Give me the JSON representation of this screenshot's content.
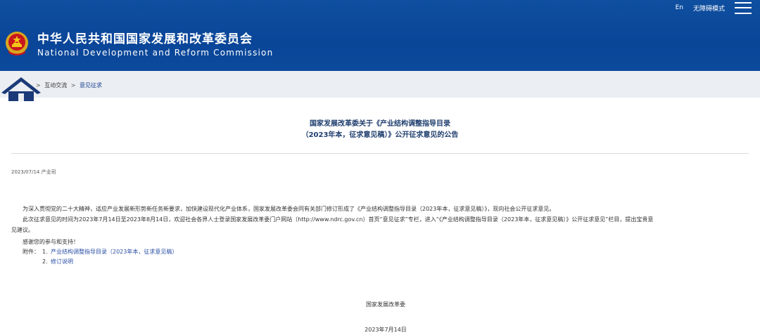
{
  "header": {
    "lang_label": "En",
    "accessibility_label": "无障碍模式",
    "title_cn": "中华人民共和国国家发展和改革委员会",
    "title_en": "National Development and Reform Commission",
    "bg_color": "#0b4a9c"
  },
  "breadcrumb": {
    "items": [
      "互动交流",
      "意见征求"
    ],
    "separator": ">"
  },
  "article": {
    "title_line1": "国家发展改革委关于《产业结构调整指导目录",
    "title_line2": "（2023年本，征求意见稿）》公开征求意见的公告",
    "meta": "2023/07/14 产业司",
    "para1": "为深入贯彻党的二十大精神，适应产业发展新形势新任务新要求，加快建设现代化产业体系，国家发展改革委会同有关部门修订形成了《产业结构调整指导目录（2023年本，征求意见稿）》，现向社会公开征求意见。",
    "para2_line1": "此次征求意见的时间为2023年7月14日至2023年8月14日，欢迎社会各界人士登录国家发展改革委门户网站（http://www.ndrc.gov.cn）首页“意见征求”专栏，进入“《产业结构调整指导目录（2023年本，征求意见稿）》公开征求意见”栏目，提出宝贵意",
    "para2_line2": "见建议。",
    "para3": "感谢您的参与和支持！",
    "attach_label": "附件：",
    "attach1_num": "1.",
    "attach1": "产业结构调整指导目录（2023年本，征求意见稿）",
    "attach2_num": "2.",
    "attach2": "修订说明",
    "sign_org": "国家发展改革委",
    "sign_date": "2023年7月14日"
  }
}
